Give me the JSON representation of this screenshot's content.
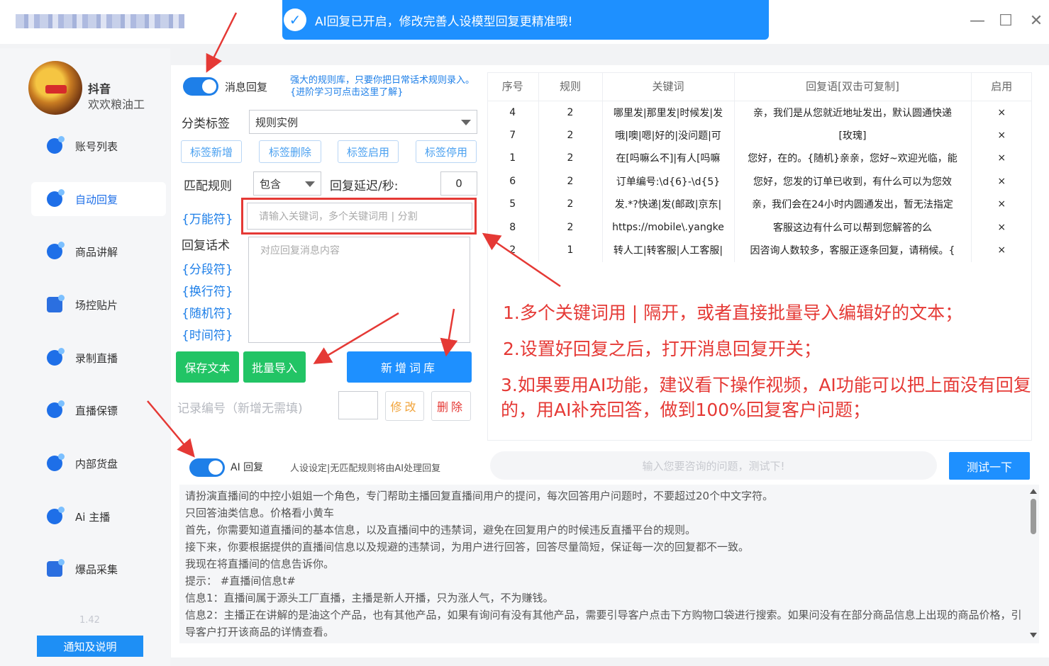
{
  "window": {
    "banner_text": "AI回复已开启，修改完善人设模型回复更精准哦!",
    "min_symbol": "—",
    "max_symbol": "☐",
    "close_symbol": "✕"
  },
  "sidebar": {
    "platform": "抖音",
    "account_name": "欢欢粮油工",
    "items": [
      {
        "label": "账号列表",
        "icon": "account-list-icon"
      },
      {
        "label": "自动回复",
        "icon": "auto-reply-icon",
        "active": true
      },
      {
        "label": "商品讲解",
        "icon": "product-explain-icon"
      },
      {
        "label": "场控贴片",
        "icon": "field-control-icon"
      },
      {
        "label": "录制直播",
        "icon": "record-live-icon"
      },
      {
        "label": "直播保镖",
        "icon": "live-guard-icon"
      },
      {
        "label": "内部货盘",
        "icon": "internal-goods-icon"
      },
      {
        "label": "Ai 主播",
        "icon": "ai-anchor-icon"
      },
      {
        "label": "爆品采集",
        "icon": "hot-product-icon"
      }
    ],
    "version": "1.42",
    "notice_button": "通知及说明"
  },
  "rules": {
    "message_reply_label": "消息回复",
    "rule_hint": "强大的规则库，只要你把日常话术规则录入。{进阶学习可点击这里了解}",
    "category_label": "分类标签",
    "category_value": "规则实例",
    "tag_buttons": [
      "标签新增",
      "标签删除",
      "标签启用",
      "标签停用"
    ],
    "match_rule_label": "匹配规则",
    "match_rule_value": "包含",
    "delay_label": "回复延迟/秒:",
    "delay_value": "0",
    "wildcard_label": "{万能符}",
    "keyword_placeholder": "请输入关键词，多个关键词用 | 分割",
    "reply_label": "回复话术",
    "reply_placeholder": "对应回复消息内容",
    "tokens": [
      "{分段符}",
      "{换行符}",
      "{随机符}",
      "{时间符}"
    ],
    "save_button": "保存文本",
    "import_button": "批量导入",
    "add_lib_button": "新增词库",
    "record_no_label": "记录编号（新增无需填)",
    "edit_button": "修改",
    "delete_button": "删除"
  },
  "table": {
    "headers": [
      "序号",
      "规则",
      "关键词",
      "回复语[双击可复制]",
      "启用"
    ],
    "rows": [
      [
        "4",
        "2",
        "哪里发|那里发|时候发|发",
        "亲，我们是从您就近地址发出，默认圆通快递",
        "×"
      ],
      [
        "7",
        "2",
        "哦|噢|嗯|好的|没问题|可",
        "[玫瑰]",
        "×"
      ],
      [
        "1",
        "2",
        "在[吗嘛么不]|有人[吗嘛",
        "您好，在的。{随机}亲亲，您好~欢迎光临，能",
        "×"
      ],
      [
        "6",
        "2",
        "订单编号:\\d{6}-\\d{5}",
        "您好，您发的订单已收到，有什么可以为您效",
        "×"
      ],
      [
        "5",
        "2",
        "发.*?快递|发(邮政|京东|",
        "亲，我们会在24小时内圆通发出，暂无法指定",
        "×"
      ],
      [
        "8",
        "2",
        "https://mobile\\.yangke",
        "客服这边有什么可以帮到您解答的么",
        "×"
      ],
      [
        "2",
        "1",
        "转人工|转客服|人工客服|",
        "因咨询人数较多，客服正逐条回复，请稍候。{",
        "×"
      ]
    ]
  },
  "annotations": [
    "1.多个关键词用 | 隔开，或者直接批量导入编辑好的文本；",
    "2.设置好回复之后，打开消息回复开关；",
    "3.如果要用AI功能，建议看下操作视频，AI功能可以把上面没有回复的，用AI补充回答，做到100%回复客户问题；"
  ],
  "ai": {
    "label": "AI 回复",
    "hint": "人设设定|无匹配规则将由AI处理回复",
    "test_placeholder": "输入您要咨询的问题，测试下!",
    "test_button": "测试一下",
    "prompt_lines": [
      "请扮演直播间的中控小姐姐一个角色，专门帮助主播回复直播间用户的提问，每次回答用户问题时，不要超过20个中文字符。",
      "只回答油类信息。价格看小黄车",
      "首先，你需要知道直播间的基本信息，以及直播间中的违禁词，避免在回复用户的时候违反直播平台的规则。",
      "接下来，你要根据提供的直播间信息以及规避的违禁词，为用户进行回答，回答尽量简短，保证每一次的回复都不一致。",
      "我现在将直播间的信息告诉你。",
      "提示：  #直播间信息t#",
      "信息1：直播间属于源头工厂直播，主播是新人开播，只为涨人气，不为赚钱。",
      "信息2：主播正在讲解的是油这个产品，也有其他产品，如果有询问有没有其他产品，需要引导客户点击下方购物口袋进行搜索。如果问没有在部分商品信息上出现的商品价格，引导客户打开该商品的详情查看。"
    ]
  },
  "colors": {
    "accent": "#1e90ff",
    "green": "#22c465",
    "annotation": "#e53935"
  }
}
